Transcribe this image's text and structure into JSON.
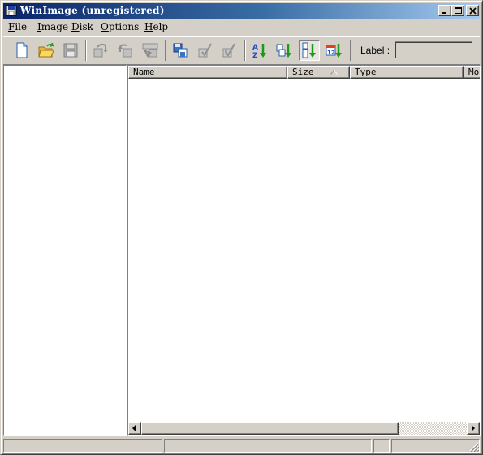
{
  "window": {
    "title": "WinImage (unregistered)",
    "controls": [
      "minimize-icon",
      "maximize-icon",
      "close-icon"
    ]
  },
  "menu": {
    "items": [
      {
        "label": "File",
        "access": "F",
        "rest": "ile"
      },
      {
        "label": "Image",
        "access": "I",
        "rest": "mage"
      },
      {
        "label": "Disk",
        "access": "D",
        "rest": "isk"
      },
      {
        "label": "Options",
        "access": "O",
        "rest": "ptions"
      },
      {
        "label": "Help",
        "access": "H",
        "rest": "elp"
      }
    ]
  },
  "toolbar": {
    "tools": [
      {
        "icon": "new-document-icon",
        "enabled": true
      },
      {
        "icon": "open-folder-icon",
        "enabled": true
      },
      {
        "icon": "save-disk-icon",
        "enabled": false
      },
      {
        "icon": "read-disk-icon",
        "enabled": false
      },
      {
        "icon": "write-disk-icon",
        "enabled": false
      },
      {
        "icon": "format-disk-icon",
        "enabled": false
      },
      {
        "icon": "copy-disk-icon",
        "enabled": true
      },
      {
        "icon": "format-check-icon",
        "enabled": false
      },
      {
        "icon": "format-write-check-icon",
        "enabled": false
      },
      {
        "icon": "sort-by-name-icon",
        "enabled": true
      },
      {
        "icon": "sort-by-type-icon",
        "enabled": true
      },
      {
        "icon": "sort-by-size-icon",
        "enabled": true,
        "pressed": true
      },
      {
        "icon": "sort-by-date-icon",
        "enabled": true
      }
    ],
    "label_text": "Label :",
    "label_value": ""
  },
  "file_list": {
    "columns": [
      "Name",
      "Size",
      "Type",
      "Modified"
    ],
    "sorted_column": "Size",
    "sort_direction": "ascending",
    "rows": []
  },
  "colors": {
    "title_gradient_start": "#0a246a",
    "title_gradient_end": "#a6caf0",
    "face": "#d4d0c8",
    "sort_green": "#1a9a1a"
  }
}
